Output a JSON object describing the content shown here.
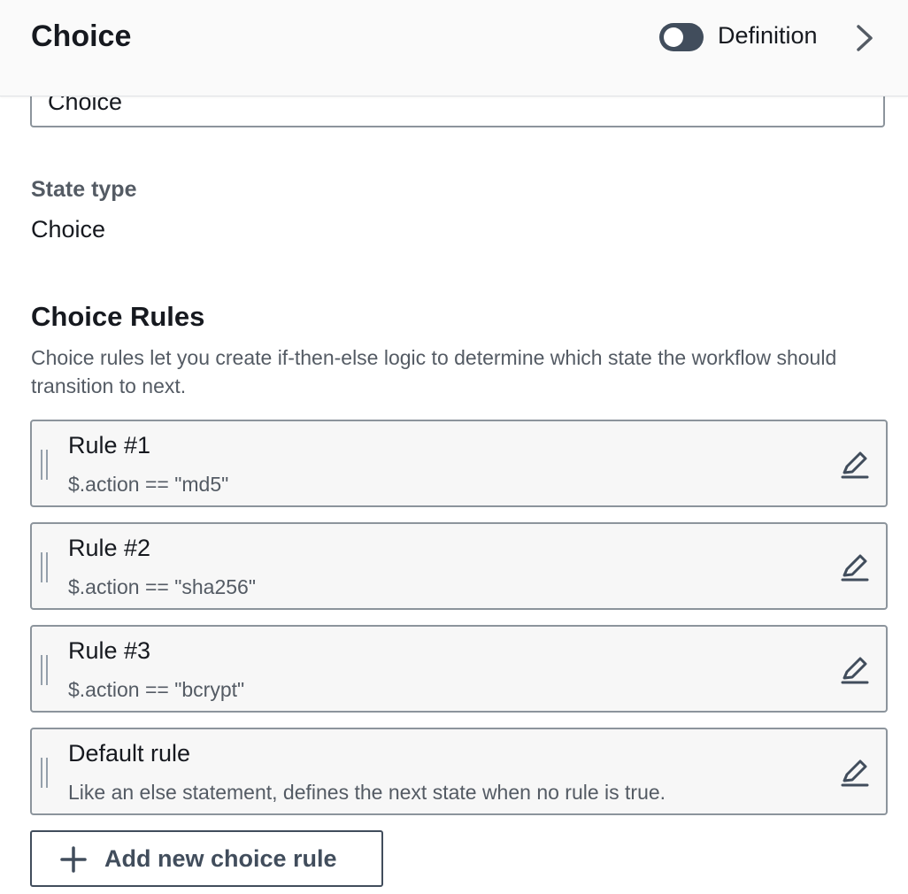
{
  "header": {
    "title": "Choice",
    "toggle_label": "Definition",
    "toggle_on": false
  },
  "name_field": {
    "value": "Choice"
  },
  "state_type": {
    "label": "State type",
    "value": "Choice"
  },
  "choice_rules": {
    "title": "Choice Rules",
    "description": "Choice rules let you create if-then-else logic to determine which state the workflow should transition to next.",
    "rules": [
      {
        "title": "Rule #1",
        "expression": "$.action == \"md5\""
      },
      {
        "title": "Rule #2",
        "expression": "$.action == \"sha256\""
      },
      {
        "title": "Rule #3",
        "expression": "$.action == \"bcrypt\""
      },
      {
        "title": "Default rule",
        "expression": "Like an else statement, defines the next state when no rule is true."
      }
    ],
    "add_button_label": "Add new choice rule"
  },
  "icons": {
    "toggle": "toggle-icon",
    "chevron": "chevron-right-icon",
    "edit": "pencil-icon",
    "drag": "drag-handle-icon",
    "add": "plus-icon"
  },
  "colors": {
    "text_primary": "#16191f",
    "text_secondary": "#545b64",
    "border": "#8c949c",
    "card_bg": "#f7f7f7",
    "toggle_bg": "#414d5c"
  }
}
